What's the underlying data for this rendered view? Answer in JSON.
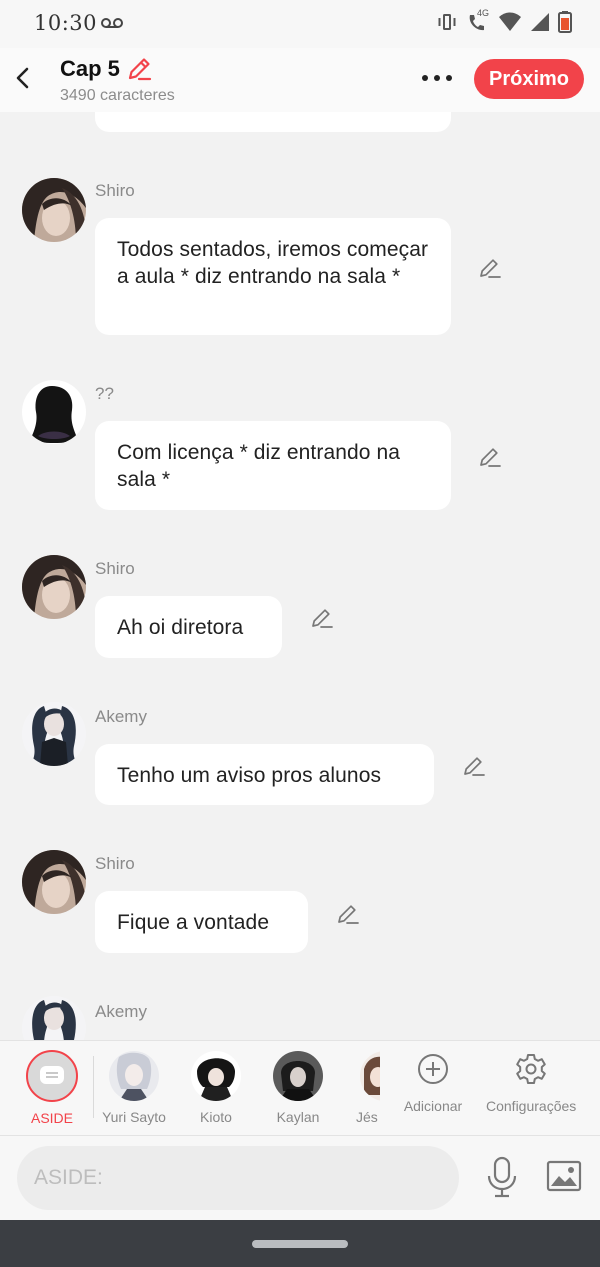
{
  "status": {
    "time": "10:30",
    "network": "4G"
  },
  "header": {
    "title": "Cap 5",
    "subtitle": "3490 caracteres",
    "next_label": "Próximo"
  },
  "messages": [
    {
      "name": "Shiro",
      "text": "Todos sentados, iremos começar a aula * diz entrando na sala *"
    },
    {
      "name": "??",
      "text": "Com licença * diz entrando na sala *"
    },
    {
      "name": "Shiro",
      "text": "Ah oi diretora"
    },
    {
      "name": "Akemy",
      "text": "Tenho um aviso pros alunos"
    },
    {
      "name": "Shiro",
      "text": "Fique a vontade"
    },
    {
      "name": "Akemy",
      "text": ""
    }
  ],
  "characters": [
    {
      "label": "ASIDE"
    },
    {
      "label": "Yuri Sayto"
    },
    {
      "label": "Kioto"
    },
    {
      "label": "Kaylan"
    },
    {
      "label": "Jés"
    }
  ],
  "actions": {
    "add_label": "Adicionar",
    "settings_label": "Configurações"
  },
  "composer": {
    "placeholder": "ASIDE:"
  },
  "colors": {
    "accent": "#f2434a",
    "background": "#f2f2f2",
    "bubble": "#ffffff",
    "name_text": "#8a8a8a"
  }
}
